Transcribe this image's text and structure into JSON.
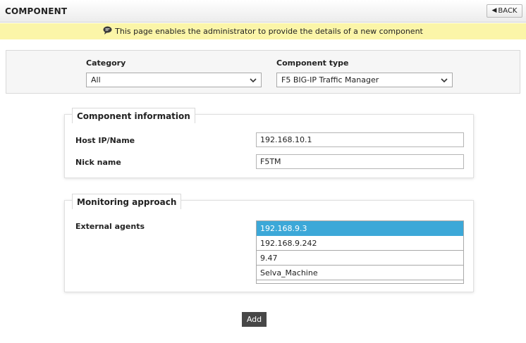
{
  "header": {
    "title": "COMPONENT",
    "back_label": "BACK"
  },
  "info_bar": {
    "message": "This page enables the administrator to provide the details of a new component"
  },
  "selectors": {
    "category": {
      "label": "Category",
      "value": "All"
    },
    "component_type": {
      "label": "Component type",
      "value": "F5 BIG-IP Traffic Manager"
    }
  },
  "component_info": {
    "legend": "Component information",
    "host": {
      "label": "Host IP/Name",
      "value": "192.168.10.1"
    },
    "nick": {
      "label": "Nick name",
      "value": "F5TM"
    }
  },
  "monitoring": {
    "legend": "Monitoring approach",
    "agents_label": "External agents",
    "agents": [
      {
        "name": "192.168.9.3",
        "selected": true
      },
      {
        "name": "192.168.9.242",
        "selected": false
      },
      {
        "name": "9.47",
        "selected": false
      },
      {
        "name": "Selva_Machine",
        "selected": false
      }
    ]
  },
  "actions": {
    "add_label": "Add"
  },
  "colors": {
    "info_bar_bg": "#fbf5a8",
    "selected_item_bg": "#3ca8d8",
    "add_button_bg": "#474747"
  }
}
